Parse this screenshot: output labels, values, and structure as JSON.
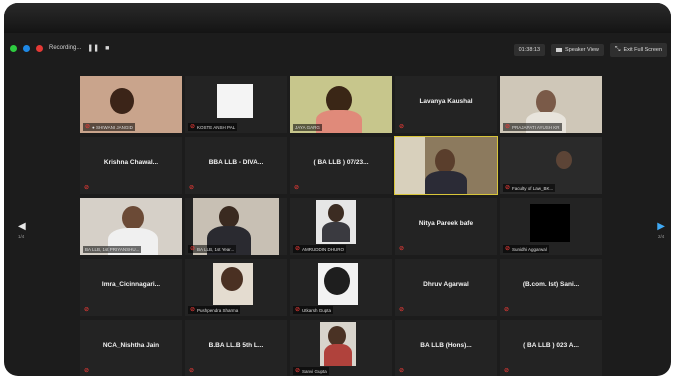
{
  "toolbar": {
    "recording_label": "Recording...",
    "view_button": "Speaker View",
    "exit_button": "Exit Full Screen",
    "meeting_time": "01:38:13"
  },
  "pagination": {
    "left": "1/4",
    "right": "2/4"
  },
  "tiles": [
    [
      "● SHIWANI JANGID",
      "KOSTE ANSH PAL",
      "JAYA GARG",
      "Lavanya Kaushal",
      "PRAJAPATI AYUSH KR"
    ],
    [
      "Krishna Chawal...",
      "BBA LLB - DIVA...",
      "( BA LLB ) 07/23...",
      "",
      "Faculty of Law_BK..."
    ],
    [
      "BA LLB, 1st PRIYANSHU...",
      "BA LLB, 1st Year...",
      "AMRUDDIN DHURO",
      "Nitya Pareek bafe",
      "Sunidhi Aggarwal"
    ],
    [
      "Imra_Cicinnagari...",
      "Pushpendra Sharma",
      "Utkarsh Gupta",
      "Dhruv Agarwal",
      "(B.com. Ist) Sani..."
    ],
    [
      "NCA_Nishtha Jain",
      "B.BA LL.B 5th L...",
      "Sanvi Gupta",
      "BA LLB (Hons)...",
      "( BA LLB ) 023 A..."
    ]
  ]
}
